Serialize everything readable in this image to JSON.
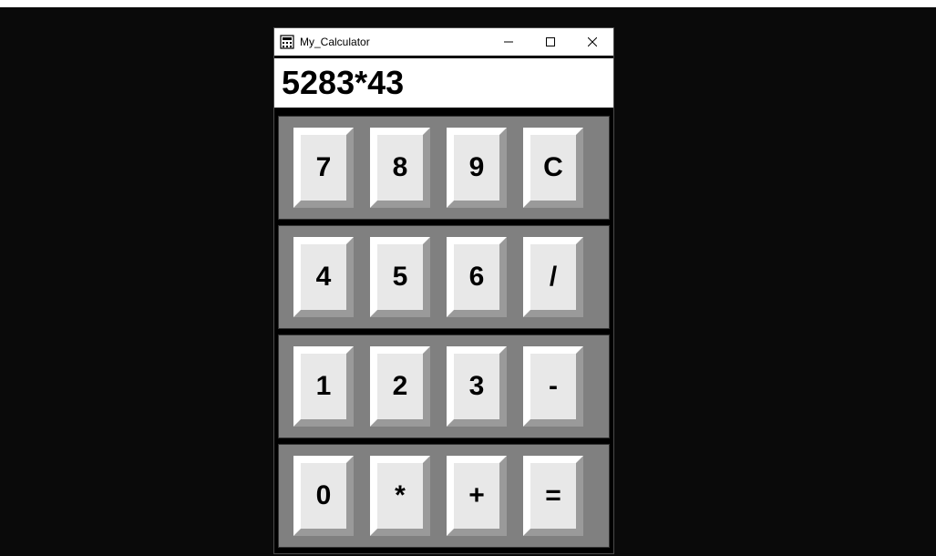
{
  "window": {
    "title": "My_Calculator"
  },
  "display": {
    "value": "5283*43"
  },
  "keys": {
    "row1": [
      "7",
      "8",
      "9",
      "C"
    ],
    "row2": [
      "4",
      "5",
      "6",
      "/"
    ],
    "row3": [
      "1",
      "2",
      "3",
      "-"
    ],
    "row4": [
      "0",
      "*",
      "+",
      "="
    ]
  },
  "colors": {
    "window_bg": "#000000",
    "titlebar_bg": "#ffffff",
    "display_bg": "#ffffff",
    "keyrow_bg": "#808080",
    "key_bg": "#e8e8e8"
  }
}
